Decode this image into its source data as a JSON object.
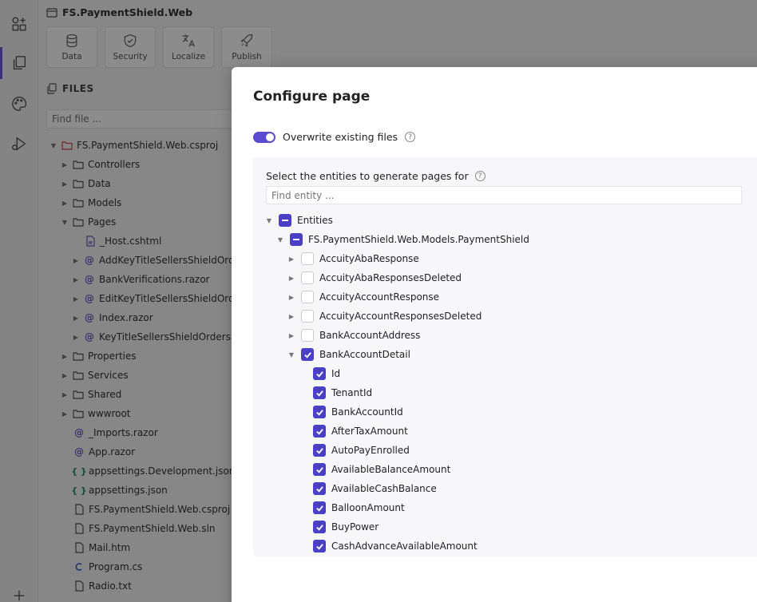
{
  "project": {
    "title": "FS.PaymentShield.Web"
  },
  "toolbar": [
    {
      "label": "Data",
      "icon": "database-icon"
    },
    {
      "label": "Security",
      "icon": "shield-icon"
    },
    {
      "label": "Localize",
      "icon": "translate-icon"
    },
    {
      "label": "Publish",
      "icon": "rocket-icon"
    }
  ],
  "files": {
    "heading": "FILES",
    "search_placeholder": "Find file ...",
    "tree": [
      {
        "label": "FS.PaymentShield.Web.csproj",
        "type": "project",
        "expanded": true
      },
      {
        "label": "Controllers",
        "type": "folder"
      },
      {
        "label": "Data",
        "type": "folder"
      },
      {
        "label": "Models",
        "type": "folder"
      },
      {
        "label": "Pages",
        "type": "folder",
        "expanded": true
      },
      {
        "label": "_Host.cshtml",
        "type": "file"
      },
      {
        "label": "AddKeyTitleSellersShieldOrders.razor",
        "type": "razor"
      },
      {
        "label": "BankVerifications.razor",
        "type": "razor"
      },
      {
        "label": "EditKeyTitleSellersShieldOrders.razor",
        "type": "razor"
      },
      {
        "label": "Index.razor",
        "type": "razor"
      },
      {
        "label": "KeyTitleSellersShieldOrders.razor",
        "type": "razor"
      },
      {
        "label": "Properties",
        "type": "folder"
      },
      {
        "label": "Services",
        "type": "folder"
      },
      {
        "label": "Shared",
        "type": "folder"
      },
      {
        "label": "wwwroot",
        "type": "folder"
      },
      {
        "label": "_Imports.razor",
        "type": "razor-plain"
      },
      {
        "label": "App.razor",
        "type": "razor-plain"
      },
      {
        "label": "appsettings.Development.json",
        "type": "json"
      },
      {
        "label": "appsettings.json",
        "type": "json"
      },
      {
        "label": "FS.PaymentShield.Web.csproj",
        "type": "file"
      },
      {
        "label": "FS.PaymentShield.Web.sln",
        "type": "file"
      },
      {
        "label": "Mail.htm",
        "type": "file"
      },
      {
        "label": "Program.cs",
        "type": "csharp"
      },
      {
        "label": "Radio.txt",
        "type": "file"
      }
    ]
  },
  "modal": {
    "title": "Configure page",
    "overwrite_label": "Overwrite existing files",
    "overwrite_on": true,
    "entities_label": "Select the entities to generate pages for",
    "entity_search_placeholder": "Find entity ...",
    "help_glyph": "?"
  },
  "entities": [
    {
      "label": "Entities",
      "state": "mixed",
      "caret": "down"
    },
    {
      "label": "FS.PaymentShield.Web.Models.PaymentShield",
      "state": "mixed",
      "caret": "down"
    },
    {
      "label": "AccuityAbaResponse",
      "state": "off",
      "caret": "right"
    },
    {
      "label": "AccuityAbaResponsesDeleted",
      "state": "off",
      "caret": "right"
    },
    {
      "label": "AccuityAccountResponse",
      "state": "off",
      "caret": "right"
    },
    {
      "label": "AccuityAccountResponsesDeleted",
      "state": "off",
      "caret": "right"
    },
    {
      "label": "BankAccountAddress",
      "state": "off",
      "caret": "right"
    },
    {
      "label": "BankAccountDetail",
      "state": "on",
      "caret": "down"
    },
    {
      "label": "Id",
      "state": "on"
    },
    {
      "label": "TenantId",
      "state": "on"
    },
    {
      "label": "BankAccountId",
      "state": "on"
    },
    {
      "label": "AfterTaxAmount",
      "state": "on"
    },
    {
      "label": "AutoPayEnrolled",
      "state": "on"
    },
    {
      "label": "AvailableBalanceAmount",
      "state": "on"
    },
    {
      "label": "AvailableCashBalance",
      "state": "on"
    },
    {
      "label": "BalloonAmount",
      "state": "on"
    },
    {
      "label": "BuyPower",
      "state": "on"
    },
    {
      "label": "CashAdvanceAvailableAmount",
      "state": "on"
    }
  ],
  "colors": {
    "accent": "#4b3fc4",
    "toggle": "#5b4bd0"
  }
}
